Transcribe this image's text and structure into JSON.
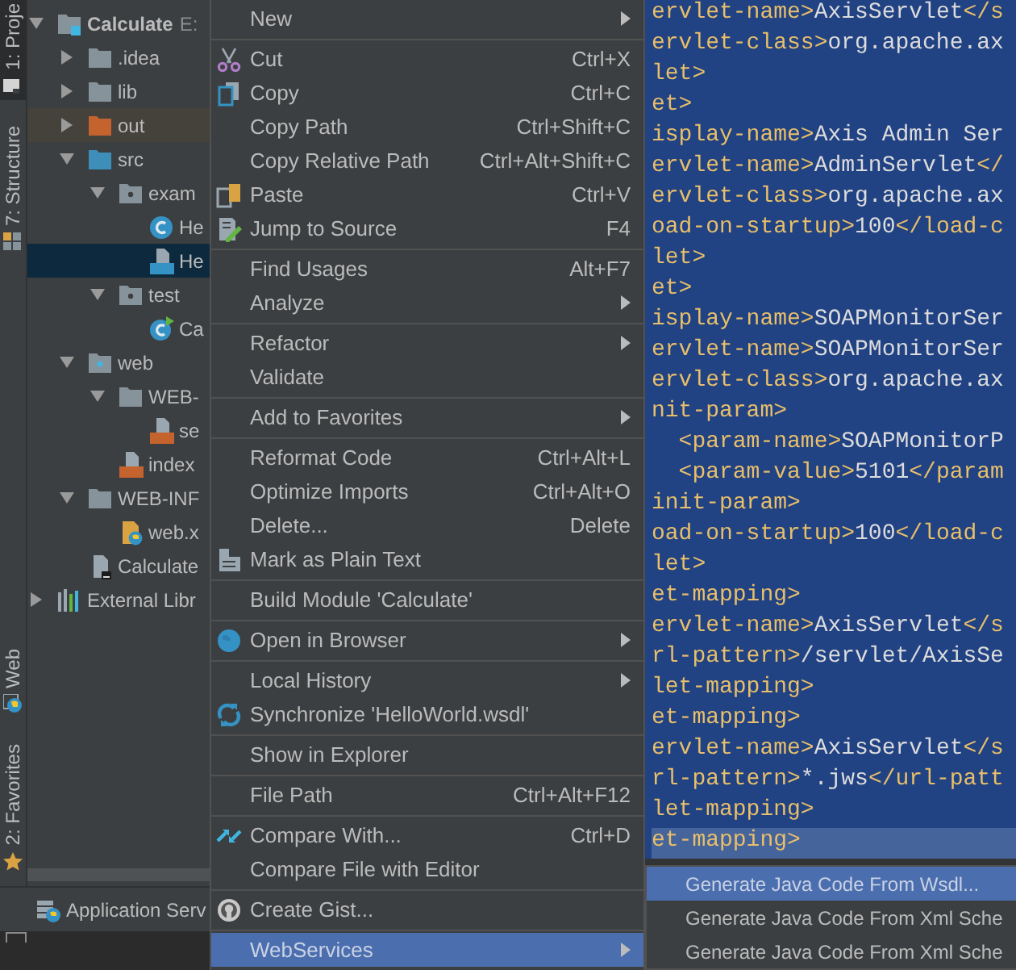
{
  "tool_strip": [
    {
      "label": "1: Proje",
      "selected": true
    },
    {
      "label": "7: Structure",
      "selected": false
    },
    {
      "label": "Web",
      "selected": false
    },
    {
      "label": "2: Favorites",
      "selected": false
    }
  ],
  "project_tree": [
    {
      "name": "Calculate",
      "location": "E:",
      "kind": "module",
      "expanded": true,
      "selected": false,
      "children": [
        {
          "name": ".idea",
          "kind": "folder",
          "expanded": false,
          "selected": false
        },
        {
          "name": "lib",
          "kind": "folder",
          "expanded": false,
          "selected": false
        },
        {
          "name": "out",
          "kind": "excluded-folder",
          "expanded": false,
          "selected": false
        },
        {
          "name": "src",
          "kind": "source-folder",
          "expanded": true,
          "selected": false,
          "children": [
            {
              "name": "exam",
              "kind": "package",
              "expanded": true,
              "selected": false,
              "children": [
                {
                  "name": "He",
                  "kind": "class",
                  "selected": false
                },
                {
                  "name": "He",
                  "kind": "wsdl",
                  "selected": true
                }
              ]
            },
            {
              "name": "test",
              "kind": "package",
              "expanded": true,
              "selected": false,
              "children": [
                {
                  "name": "Ca",
                  "kind": "test-class",
                  "selected": false
                }
              ]
            }
          ]
        },
        {
          "name": "web",
          "kind": "web-folder",
          "expanded": true,
          "selected": false,
          "children": [
            {
              "name": "WEB-",
              "kind": "folder",
              "expanded": true,
              "selected": false,
              "children": [
                {
                  "name": "se",
                  "kind": "xml",
                  "selected": false
                }
              ]
            },
            {
              "name": "index",
              "kind": "jsp",
              "selected": false
            }
          ]
        },
        {
          "name": "WEB-INF",
          "kind": "folder",
          "expanded": true,
          "selected": false,
          "children": [
            {
              "name": "web.x",
              "kind": "web-xml",
              "selected": false
            }
          ]
        },
        {
          "name": "Calculate",
          "kind": "iml",
          "selected": false
        }
      ]
    },
    {
      "name": "External Libr",
      "kind": "library",
      "expanded": false,
      "selected": false
    }
  ],
  "tool_window_bar": {
    "label": "Application Serv"
  },
  "context_menu": [
    {
      "kind": "item",
      "label": "New",
      "submenu": true,
      "selected": false
    },
    {
      "kind": "separator"
    },
    {
      "kind": "item",
      "label": "Cut",
      "shortcut": "Ctrl+X",
      "selected": false
    },
    {
      "kind": "item",
      "label": "Copy",
      "shortcut": "Ctrl+C",
      "selected": false
    },
    {
      "kind": "item",
      "label": "Copy Path",
      "shortcut": "Ctrl+Shift+C",
      "selected": false
    },
    {
      "kind": "item",
      "label": "Copy Relative Path",
      "shortcut": "Ctrl+Alt+Shift+C",
      "selected": false
    },
    {
      "kind": "item",
      "label": "Paste",
      "shortcut": "Ctrl+V",
      "selected": false
    },
    {
      "kind": "item",
      "label": "Jump to Source",
      "shortcut": "F4",
      "selected": false
    },
    {
      "kind": "separator"
    },
    {
      "kind": "item",
      "label": "Find Usages",
      "shortcut": "Alt+F7",
      "selected": false
    },
    {
      "kind": "item",
      "label": "Analyze",
      "submenu": true,
      "selected": false
    },
    {
      "kind": "separator"
    },
    {
      "kind": "item",
      "label": "Refactor",
      "submenu": true,
      "selected": false
    },
    {
      "kind": "item",
      "label": "Validate",
      "selected": false
    },
    {
      "kind": "separator"
    },
    {
      "kind": "item",
      "label": "Add to Favorites",
      "submenu": true,
      "selected": false
    },
    {
      "kind": "separator"
    },
    {
      "kind": "item",
      "label": "Reformat Code",
      "shortcut": "Ctrl+Alt+L",
      "selected": false
    },
    {
      "kind": "item",
      "label": "Optimize Imports",
      "shortcut": "Ctrl+Alt+O",
      "selected": false
    },
    {
      "kind": "item",
      "label": "Delete...",
      "shortcut": "Delete",
      "selected": false
    },
    {
      "kind": "item",
      "label": "Mark as Plain Text",
      "selected": false
    },
    {
      "kind": "separator"
    },
    {
      "kind": "item",
      "label": "Build Module 'Calculate'",
      "selected": false
    },
    {
      "kind": "separator"
    },
    {
      "kind": "item",
      "label": "Open in Browser",
      "submenu": true,
      "selected": false
    },
    {
      "kind": "separator"
    },
    {
      "kind": "item",
      "label": "Local History",
      "submenu": true,
      "selected": false
    },
    {
      "kind": "item",
      "label": "Synchronize 'HelloWorld.wsdl'",
      "selected": false
    },
    {
      "kind": "separator"
    },
    {
      "kind": "item",
      "label": "Show in Explorer",
      "selected": false
    },
    {
      "kind": "separator"
    },
    {
      "kind": "item",
      "label": "File Path",
      "shortcut": "Ctrl+Alt+F12",
      "selected": false
    },
    {
      "kind": "separator"
    },
    {
      "kind": "item",
      "label": "Compare With...",
      "shortcut": "Ctrl+D",
      "selected": false
    },
    {
      "kind": "item",
      "label": "Compare File with Editor",
      "selected": false
    },
    {
      "kind": "separator"
    },
    {
      "kind": "item",
      "label": "Create Gist...",
      "selected": false
    },
    {
      "kind": "separator"
    },
    {
      "kind": "item",
      "label": "WebServices",
      "submenu": true,
      "selected": true
    }
  ],
  "editor": {
    "lines": [
      {
        "current": false,
        "parts": [
          {
            "kind": "tag",
            "text": "ervlet-name>"
          },
          {
            "kind": "value",
            "text": "AxisServlet"
          },
          {
            "kind": "tag",
            "text": "</s"
          }
        ]
      },
      {
        "current": false,
        "parts": [
          {
            "kind": "tag",
            "text": "ervlet-class>"
          },
          {
            "kind": "value",
            "text": "org.apache.ax"
          }
        ]
      },
      {
        "current": false,
        "parts": [
          {
            "kind": "tag",
            "text": "let>"
          }
        ]
      },
      {
        "current": false,
        "parts": [
          {
            "kind": "tag",
            "text": "et>"
          }
        ]
      },
      {
        "current": false,
        "parts": [
          {
            "kind": "tag",
            "text": "isplay-name>"
          },
          {
            "kind": "value",
            "text": "Axis Admin Ser"
          }
        ]
      },
      {
        "current": false,
        "parts": [
          {
            "kind": "tag",
            "text": "ervlet-name>"
          },
          {
            "kind": "value",
            "text": "AdminServlet"
          },
          {
            "kind": "tag",
            "text": "</"
          }
        ]
      },
      {
        "current": false,
        "parts": [
          {
            "kind": "tag",
            "text": "ervlet-class>"
          },
          {
            "kind": "value",
            "text": "org.apache.ax"
          }
        ]
      },
      {
        "current": false,
        "parts": [
          {
            "kind": "tag",
            "text": "oad-on-startup>"
          },
          {
            "kind": "value",
            "text": "100"
          },
          {
            "kind": "tag",
            "text": "</load-c"
          }
        ]
      },
      {
        "current": false,
        "parts": [
          {
            "kind": "tag",
            "text": "let>"
          }
        ]
      },
      {
        "current": false,
        "parts": [
          {
            "kind": "tag",
            "text": "et>"
          }
        ]
      },
      {
        "current": false,
        "parts": [
          {
            "kind": "tag",
            "text": "isplay-name>"
          },
          {
            "kind": "value",
            "text": "SOAPMonitorSer"
          }
        ]
      },
      {
        "current": false,
        "parts": [
          {
            "kind": "tag",
            "text": "ervlet-name>"
          },
          {
            "kind": "value",
            "text": "SOAPMonitorSer"
          }
        ]
      },
      {
        "current": false,
        "parts": [
          {
            "kind": "tag",
            "text": "ervlet-class>"
          },
          {
            "kind": "value",
            "text": "org.apache.ax"
          }
        ]
      },
      {
        "current": false,
        "parts": [
          {
            "kind": "tag",
            "text": "nit-param>"
          }
        ]
      },
      {
        "current": false,
        "parts": [
          {
            "kind": "tag",
            "text": "  <param-name>"
          },
          {
            "kind": "value",
            "text": "SOAPMonitorP"
          }
        ]
      },
      {
        "current": false,
        "parts": [
          {
            "kind": "tag",
            "text": "  <param-value>"
          },
          {
            "kind": "value",
            "text": "5101"
          },
          {
            "kind": "tag",
            "text": "</param"
          }
        ]
      },
      {
        "current": false,
        "parts": [
          {
            "kind": "tag",
            "text": "init-param>"
          }
        ]
      },
      {
        "current": false,
        "parts": [
          {
            "kind": "tag",
            "text": "oad-on-startup>"
          },
          {
            "kind": "value",
            "text": "100"
          },
          {
            "kind": "tag",
            "text": "</load-c"
          }
        ]
      },
      {
        "current": false,
        "parts": [
          {
            "kind": "tag",
            "text": "let>"
          }
        ]
      },
      {
        "current": false,
        "parts": [
          {
            "kind": "tag",
            "text": "et-mapping>"
          }
        ]
      },
      {
        "current": false,
        "parts": [
          {
            "kind": "tag",
            "text": "ervlet-name>"
          },
          {
            "kind": "value",
            "text": "AxisServlet"
          },
          {
            "kind": "tag",
            "text": "</s"
          }
        ]
      },
      {
        "current": false,
        "parts": [
          {
            "kind": "tag",
            "text": "rl-pattern>"
          },
          {
            "kind": "value",
            "text": "/servlet/AxisSe"
          }
        ]
      },
      {
        "current": false,
        "parts": [
          {
            "kind": "tag",
            "text": "let-mapping>"
          }
        ]
      },
      {
        "current": false,
        "parts": [
          {
            "kind": "tag",
            "text": "et-mapping>"
          }
        ]
      },
      {
        "current": false,
        "parts": [
          {
            "kind": "tag",
            "text": "ervlet-name>"
          },
          {
            "kind": "value",
            "text": "AxisServlet"
          },
          {
            "kind": "tag",
            "text": "</s"
          }
        ]
      },
      {
        "current": false,
        "parts": [
          {
            "kind": "tag",
            "text": "rl-pattern>"
          },
          {
            "kind": "value",
            "text": "*.jws"
          },
          {
            "kind": "tag",
            "text": "</url-patt"
          }
        ]
      },
      {
        "current": false,
        "parts": [
          {
            "kind": "tag",
            "text": "let-mapping>"
          }
        ]
      },
      {
        "current": true,
        "parts": [
          {
            "kind": "tag",
            "text": "et-mapping>"
          }
        ]
      }
    ]
  },
  "submenu": [
    {
      "label": "Generate Java Code From Wsdl...",
      "selected": true
    },
    {
      "label": "Generate Java Code From Xml Sche",
      "selected": false
    },
    {
      "label": "Generate Java Code From Xml Sche",
      "selected": false
    }
  ]
}
